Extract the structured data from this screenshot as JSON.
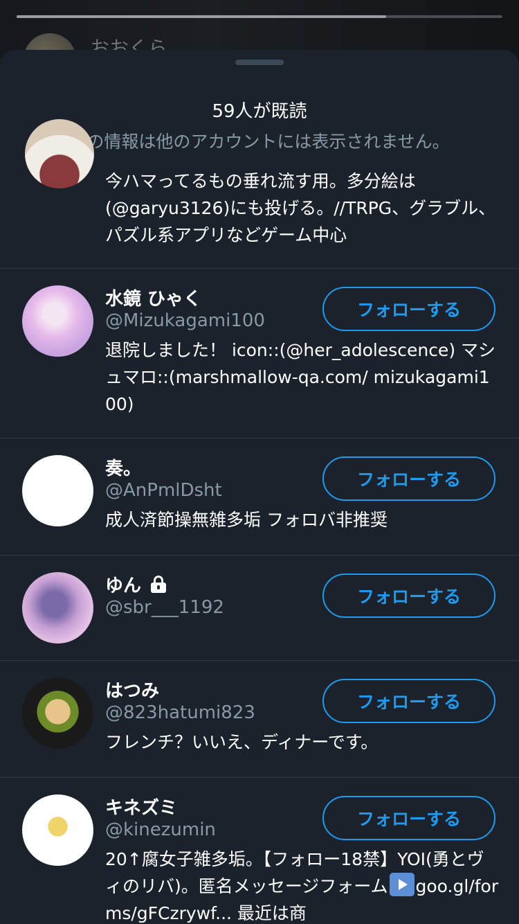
{
  "background": {
    "story_user_name": "おおくら",
    "story_progress": 0.76
  },
  "sheet": {
    "title": "59人が既読",
    "subtitle": "この情報は他のアカウントには表示されません。"
  },
  "partial_item": {
    "bio": "今ハマってるもの垂れ流す用。多分絵は(@garyu3126)にも投げる。//TRPG、グラブル、パズル系アプリなどゲーム中心"
  },
  "users": [
    {
      "display_name": "水鏡 ひゃく",
      "handle": "@Mizukagami100",
      "bio": "退院しました！ icon::(@her_adolescence) マシュマロ::(marshmallow-qa.com/ mizukagami100)",
      "follow_label": "フォローする",
      "protected": false
    },
    {
      "display_name": "奏。",
      "handle": "@AnPmlDsht",
      "bio": "成人済節操無雑多垢 フォロバ非推奨",
      "follow_label": "フォローする",
      "protected": false
    },
    {
      "display_name": "ゆん",
      "handle": "@sbr___1192",
      "bio": "",
      "follow_label": "フォローする",
      "protected": true
    },
    {
      "display_name": "はつみ",
      "handle": "@823hatumi823",
      "bio": "フレンチ？いいえ、ディナーです。",
      "follow_label": "フォローする",
      "protected": false
    },
    {
      "display_name": "キネズミ",
      "handle": "@kinezumin",
      "bio_part1": "20↑腐女子雑多垢。【フォロー18禁】YOI(勇とヴィのリバ)。匿名メッセージフォーム",
      "bio_part2": "goo.gl/forms/gFCzrywf... 最近は商",
      "follow_label": "フォローする",
      "protected": false
    }
  ],
  "colors": {
    "sheet_bg": "#1b222b",
    "accent": "#1d9bf0",
    "secondary_text": "#8899a6",
    "divider": "#2f3a45"
  }
}
